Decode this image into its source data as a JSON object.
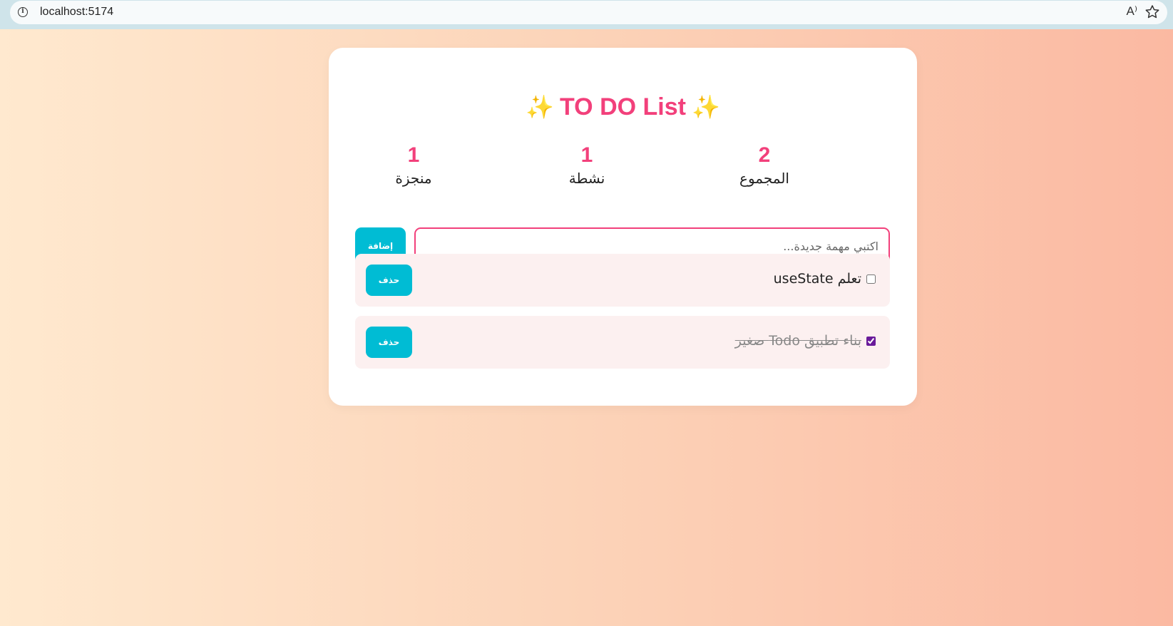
{
  "browser": {
    "url": "localhost:5174",
    "read_aloud_glyph": "A⁾"
  },
  "header": {
    "title": "TO DO List",
    "sparkle": "✨"
  },
  "stats": {
    "total": {
      "value": "2",
      "label": "المجموع"
    },
    "active": {
      "value": "1",
      "label": "نشطة"
    },
    "done": {
      "value": "1",
      "label": "منجزة"
    }
  },
  "form": {
    "placeholder": "اكتبي مهمة جديدة...",
    "value": "",
    "add_label": "إضافة"
  },
  "todos": [
    {
      "text": "تعلم useState",
      "completed": false,
      "delete_label": "حذف"
    },
    {
      "text": "بناء تطبيق Todo صغير",
      "completed": true,
      "delete_label": "حذف"
    }
  ],
  "colors": {
    "accent": "#f2407b",
    "button": "#00bcd4",
    "item_bg": "#fcf0f0",
    "check": "#6a1b9a"
  }
}
